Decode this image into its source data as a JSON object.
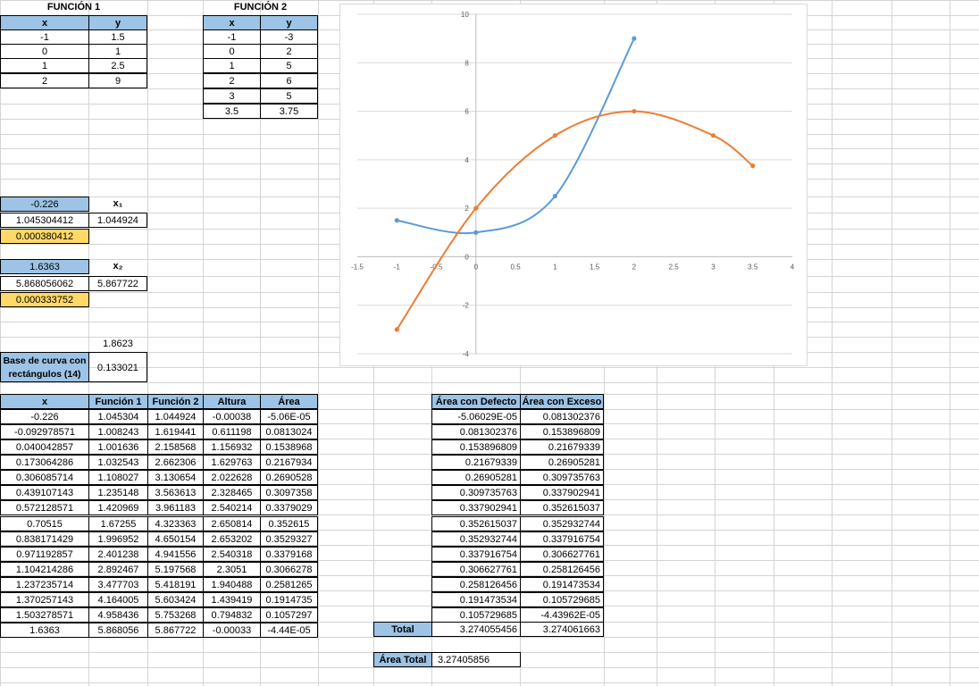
{
  "f1": {
    "title": "FUNCIÓN 1",
    "hx": "x",
    "hy": "y",
    "x": [
      "-1",
      "0",
      "1",
      "2"
    ],
    "y": [
      "1.5",
      "1",
      "2.5",
      "9"
    ]
  },
  "f2": {
    "title": "FUNCIÓN 2",
    "hx": "x",
    "hy": "y",
    "x": [
      "-1",
      "0",
      "1",
      "2",
      "3",
      "3.5"
    ],
    "y": [
      "-3",
      "2",
      "5",
      "6",
      "5",
      "3.75"
    ]
  },
  "r1": {
    "x": "-0.226",
    "label": "x₁",
    "f1": "1.045304412",
    "f2": "1.044924",
    "diff": "0.000380412"
  },
  "r2": {
    "x": "1.6363",
    "label": "x₂",
    "f1": "5.868056062",
    "f2": "5.867722",
    "diff": "0.000333752"
  },
  "width_value": "1.8623",
  "base": {
    "label": "Base de curva con rectángulos (14)",
    "value": "0.133021"
  },
  "table": {
    "headers": [
      "x",
      "Función 1",
      "Función 2",
      "Altura",
      "Área"
    ],
    "rows": [
      [
        "-0.226",
        "1.045304",
        "1.044924",
        "-0.00038",
        "-5.06E-05"
      ],
      [
        "-0.092978571",
        "1.008243",
        "1.619441",
        "0.611198",
        "0.0813024"
      ],
      [
        "0.040042857",
        "1.001636",
        "2.158568",
        "1.156932",
        "0.1538968"
      ],
      [
        "0.173064286",
        "1.032543",
        "2.662306",
        "1.629763",
        "0.2167934"
      ],
      [
        "0.306085714",
        "1.108027",
        "3.130654",
        "2.022628",
        "0.2690528"
      ],
      [
        "0.439107143",
        "1.235148",
        "3.563613",
        "2.328465",
        "0.3097358"
      ],
      [
        "0.572128571",
        "1.420969",
        "3.961183",
        "2.540214",
        "0.3379029"
      ],
      [
        "0.70515",
        "1.67255",
        "4.323363",
        "2.650814",
        "0.352615"
      ],
      [
        "0.838171429",
        "1.996952",
        "4.650154",
        "2.653202",
        "0.3529327"
      ],
      [
        "0.971192857",
        "2.401238",
        "4.941556",
        "2.540318",
        "0.3379168"
      ],
      [
        "1.104214286",
        "2.892467",
        "5.197568",
        "2.3051",
        "0.3066278"
      ],
      [
        "1.237235714",
        "3.477703",
        "5.418191",
        "1.940488",
        "0.2581265"
      ],
      [
        "1.370257143",
        "4.164005",
        "5.603424",
        "1.439419",
        "0.1914735"
      ],
      [
        "1.503278571",
        "4.958436",
        "5.753268",
        "0.794832",
        "0.1057297"
      ],
      [
        "1.6363",
        "5.868056",
        "5.867722",
        "-0.00033",
        "-4.44E-05"
      ]
    ]
  },
  "areas": {
    "headers": [
      "Área con Defecto",
      "Área con Exceso"
    ],
    "rows": [
      [
        "-5.06029E-05",
        "0.081302376"
      ],
      [
        "0.081302376",
        "0.153896809"
      ],
      [
        "0.153896809",
        "0.21679339"
      ],
      [
        "0.21679339",
        "0.26905281"
      ],
      [
        "0.26905281",
        "0.309735763"
      ],
      [
        "0.309735763",
        "0.337902941"
      ],
      [
        "0.337902941",
        "0.352615037"
      ],
      [
        "0.352615037",
        "0.352932744"
      ],
      [
        "0.352932744",
        "0.337916754"
      ],
      [
        "0.337916754",
        "0.306627761"
      ],
      [
        "0.306627761",
        "0.258126456"
      ],
      [
        "0.258126456",
        "0.191473534"
      ],
      [
        "0.191473534",
        "0.105729685"
      ],
      [
        "0.105729685",
        "-4.43962E-05"
      ]
    ],
    "total_label": "Total",
    "totals": [
      "3.274055456",
      "3.274061663"
    ],
    "grand_label": "Área Total",
    "grand_value": "3.27405856"
  },
  "colors": {
    "header_blue": "#9DC3E6",
    "highlight_yellow": "#FFD966",
    "series1": "#5B9BD5",
    "series2": "#ED7D31"
  },
  "chart_data": {
    "type": "scatter",
    "smooth": true,
    "xlim": [
      -1.5,
      4
    ],
    "ylim": [
      -4,
      10
    ],
    "xticks": [
      "-1.5",
      "-1",
      "-0.5",
      "0",
      "0.5",
      "1",
      "1.5",
      "2",
      "2.5",
      "3",
      "3.5",
      "4"
    ],
    "yticks": [
      "-4",
      "-2",
      "0",
      "2",
      "4",
      "6",
      "8",
      "10"
    ],
    "grid": true,
    "legend": "none",
    "series": [
      {
        "color": "#5B9BD5",
        "x": [
          -1,
          0,
          1,
          2
        ],
        "y": [
          1.5,
          1,
          2.5,
          9
        ]
      },
      {
        "color": "#ED7D31",
        "x": [
          -1,
          0,
          1,
          2,
          3,
          3.5
        ],
        "y": [
          -3,
          2,
          5,
          6,
          5,
          3.75
        ]
      }
    ]
  }
}
